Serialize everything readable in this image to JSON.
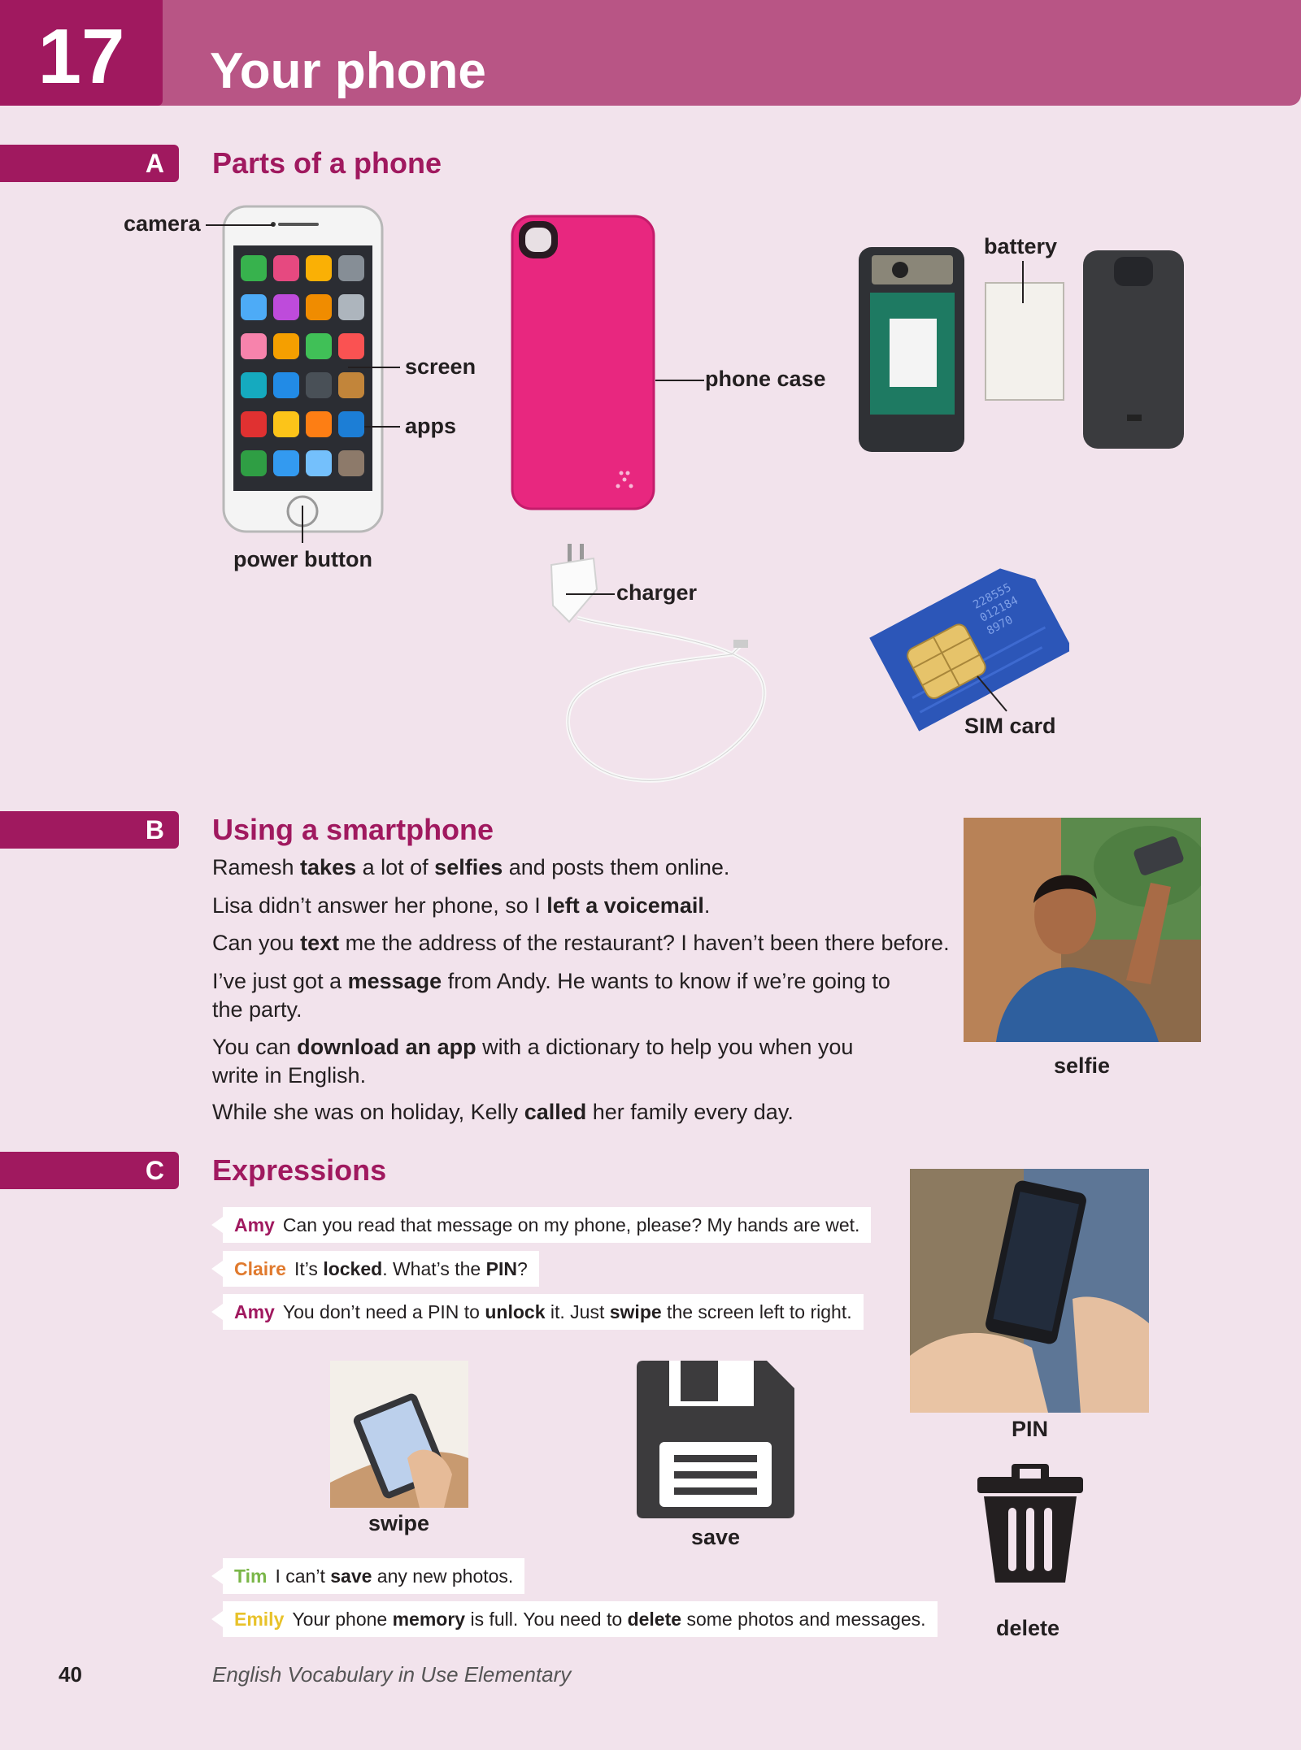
{
  "header": {
    "unit_number": "17",
    "unit_title": "Your phone"
  },
  "sections": {
    "a": {
      "letter": "A",
      "title": "Parts of a phone",
      "labels": {
        "camera": "camera",
        "screen": "screen",
        "apps": "apps",
        "power_button": "power button",
        "phone_case": "phone case",
        "battery": "battery",
        "charger": "charger",
        "sim_card": "SIM card"
      }
    },
    "b": {
      "letter": "B",
      "title": "Using a smartphone",
      "sentences": [
        [
          {
            "t": "Ramesh "
          },
          {
            "t": "takes",
            "b": true
          },
          {
            "t": " a lot of "
          },
          {
            "t": "selfies",
            "b": true
          },
          {
            "t": " and posts them online."
          }
        ],
        [
          {
            "t": "Lisa didn’t answer her phone, so I "
          },
          {
            "t": "left a voicemail",
            "b": true
          },
          {
            "t": "."
          }
        ],
        [
          {
            "t": "Can you "
          },
          {
            "t": "text",
            "b": true
          },
          {
            "t": " me the address of the restaurant? I haven’t been there before."
          }
        ],
        [
          {
            "t": "I’ve just got a "
          },
          {
            "t": "message",
            "b": true
          },
          {
            "t": " from Andy. He wants to know if we’re going to the party."
          }
        ],
        [
          {
            "t": "You can "
          },
          {
            "t": "download an app",
            "b": true
          },
          {
            "t": " with a dictionary to help you when you write in English."
          }
        ],
        [
          {
            "t": "While she was on holiday, Kelly "
          },
          {
            "t": "called",
            "b": true
          },
          {
            "t": " her family every day."
          }
        ]
      ],
      "selfie_label": "selfie"
    },
    "c": {
      "letter": "C",
      "title": "Expressions",
      "dialogue1": [
        {
          "speaker": "Amy",
          "color": "#a0195f",
          "parts": [
            {
              "t": "Can you read that message on my phone, please? My hands are wet."
            }
          ]
        },
        {
          "speaker": "Claire",
          "color": "#e07a2e",
          "parts": [
            {
              "t": "It’s "
            },
            {
              "t": "locked",
              "b": true
            },
            {
              "t": ". What’s the "
            },
            {
              "t": "PIN",
              "b": true
            },
            {
              "t": "?"
            }
          ]
        },
        {
          "speaker": "Amy",
          "color": "#a0195f",
          "parts": [
            {
              "t": "You don’t need a PIN to "
            },
            {
              "t": "unlock",
              "b": true
            },
            {
              "t": " it. Just "
            },
            {
              "t": "swipe",
              "b": true
            },
            {
              "t": " the screen left to right."
            }
          ]
        }
      ],
      "dialogue2": [
        {
          "speaker": "Tim",
          "color": "#7ab648",
          "parts": [
            {
              "t": "I can’t "
            },
            {
              "t": "save",
              "b": true
            },
            {
              "t": " any new photos."
            }
          ]
        },
        {
          "speaker": "Emily",
          "color": "#e8c22a",
          "parts": [
            {
              "t": "Your phone "
            },
            {
              "t": "memory",
              "b": true
            },
            {
              "t": " is full. You need to "
            },
            {
              "t": "delete",
              "b": true
            },
            {
              "t": " some photos and messages."
            }
          ]
        }
      ],
      "labels": {
        "pin": "PIN",
        "swipe": "swipe",
        "save": "save",
        "delete": "delete"
      }
    }
  },
  "footer": {
    "page_number": "40",
    "book_title": "English Vocabulary in Use Elementary"
  }
}
